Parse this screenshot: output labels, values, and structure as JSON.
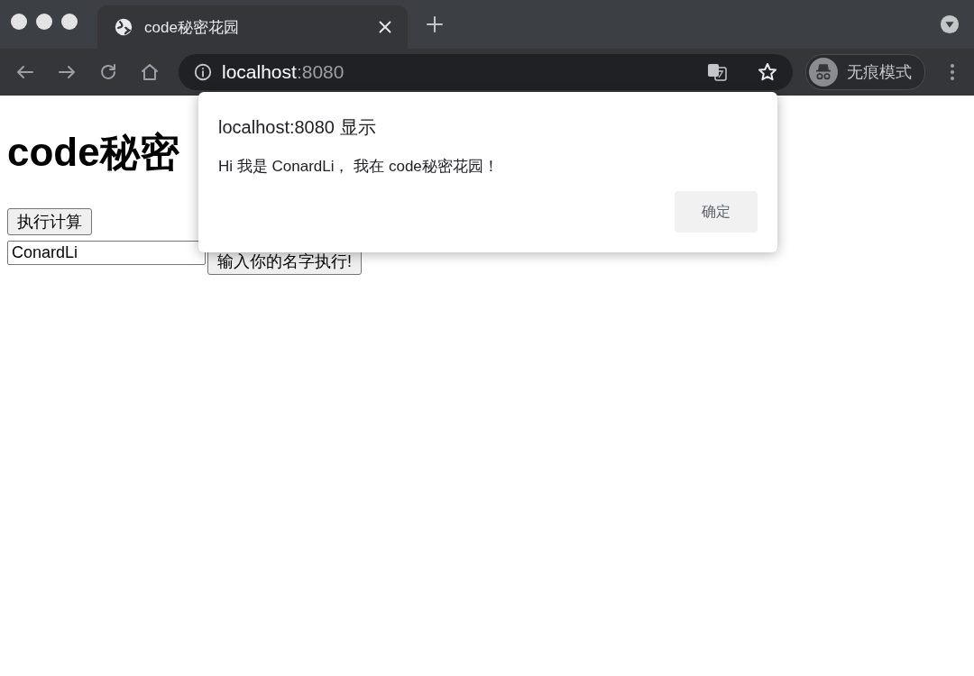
{
  "browser": {
    "tab": {
      "title": "code秘密花园",
      "selected": true
    },
    "address": {
      "host": "localhost",
      "port": ":8080"
    },
    "profile": {
      "label": "无痕模式"
    }
  },
  "page": {
    "heading": "code秘密",
    "buttons": [
      {
        "label": "执行计算"
      }
    ],
    "name_field": {
      "value": "ConardLi"
    },
    "name_button": {
      "label": "输入你的名字执行!"
    }
  },
  "dialog": {
    "title": "localhost:8080 显示",
    "message": "Hi 我是 ConardLi， 我在 code秘密花园！",
    "buttons": [
      "确定"
    ]
  }
}
